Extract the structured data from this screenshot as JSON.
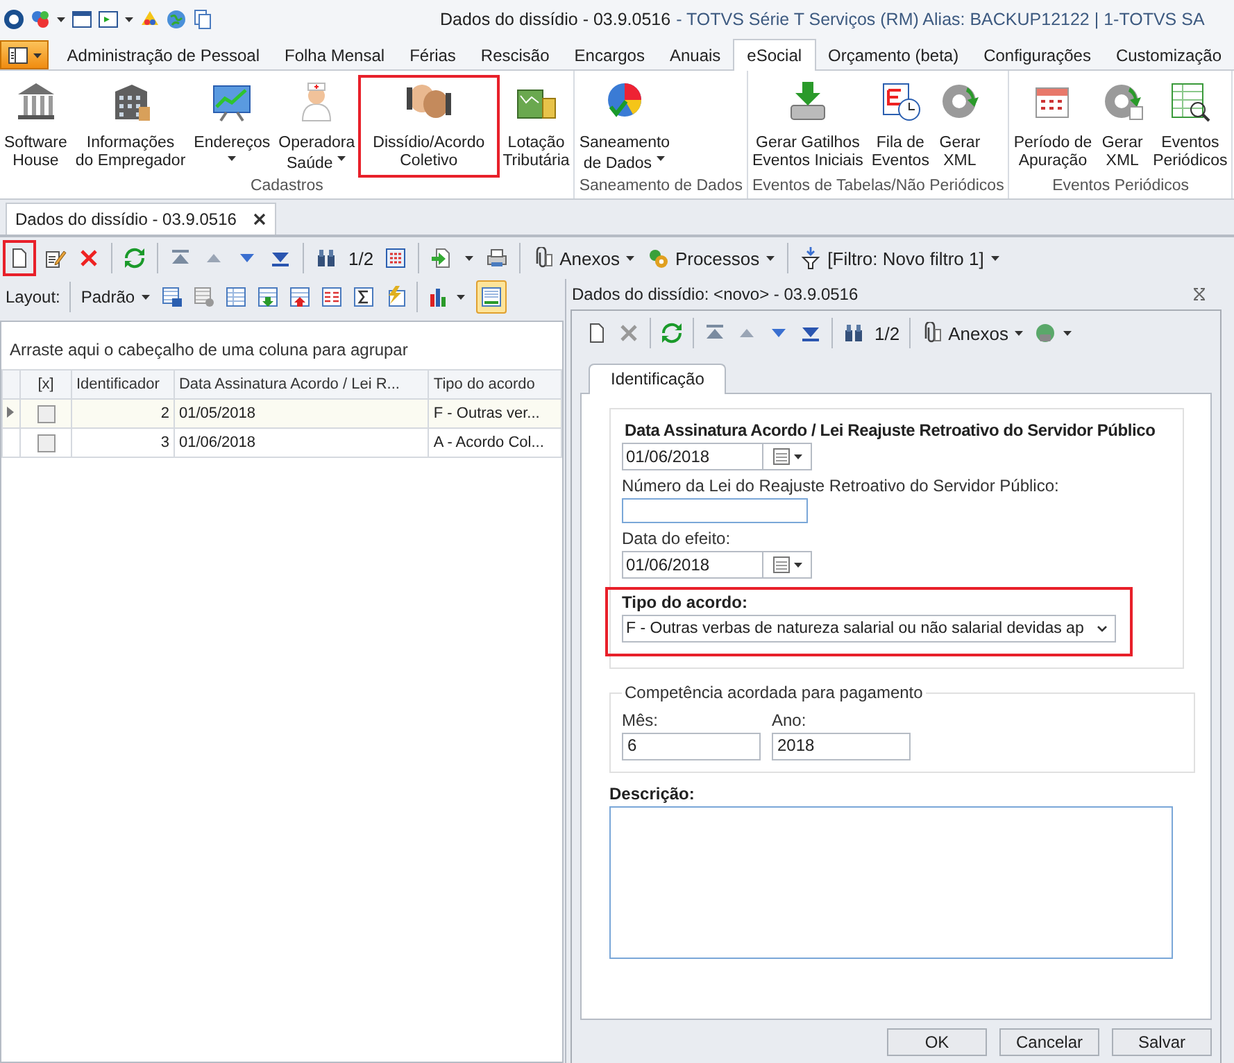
{
  "window": {
    "title": "Dados do dissídio - 03.9.0516",
    "subtitle": "- TOTVS Série T Serviços (RM) Alias: BACKUP12122 | 1-TOTVS SA"
  },
  "ribbon_tabs": [
    {
      "label": "Administração de Pessoal",
      "selected": false
    },
    {
      "label": "Folha Mensal",
      "selected": false
    },
    {
      "label": "Férias",
      "selected": false
    },
    {
      "label": "Rescisão",
      "selected": false
    },
    {
      "label": "Encargos",
      "selected": false
    },
    {
      "label": "Anuais",
      "selected": false
    },
    {
      "label": "eSocial",
      "selected": true
    },
    {
      "label": "Orçamento (beta)",
      "selected": false
    },
    {
      "label": "Configurações",
      "selected": false
    },
    {
      "label": "Customização",
      "selected": false
    }
  ],
  "ribbon_groups": [
    {
      "label": "Cadastros",
      "buttons": [
        {
          "lines": [
            "Software",
            "House"
          ],
          "dropdown": false,
          "highlighted": false
        },
        {
          "lines": [
            "Informações",
            "do Empregador"
          ],
          "dropdown": false,
          "highlighted": false
        },
        {
          "lines": [
            "Endereços"
          ],
          "dropdown": true,
          "highlighted": false
        },
        {
          "lines": [
            "Operadora",
            "Saúde"
          ],
          "dropdown": true,
          "highlighted": false
        },
        {
          "lines": [
            "Dissídio/Acordo",
            "Coletivo"
          ],
          "dropdown": false,
          "highlighted": true
        },
        {
          "lines": [
            "Lotação",
            "Tributária"
          ],
          "dropdown": false,
          "highlighted": false
        }
      ]
    },
    {
      "label": "Saneamento de Dados",
      "buttons": [
        {
          "lines": [
            "Saneamento",
            "de Dados"
          ],
          "dropdown": true,
          "highlighted": false
        }
      ]
    },
    {
      "label": "Eventos de Tabelas/Não Periódicos",
      "buttons": [
        {
          "lines": [
            "Gerar Gatilhos",
            "Eventos Iniciais"
          ],
          "dropdown": false,
          "highlighted": false
        },
        {
          "lines": [
            "Fila de",
            "Eventos"
          ],
          "dropdown": false,
          "highlighted": false
        },
        {
          "lines": [
            "Gerar",
            "XML"
          ],
          "dropdown": false,
          "highlighted": false
        }
      ]
    },
    {
      "label": "Eventos Periódicos",
      "buttons": [
        {
          "lines": [
            "Período de",
            "Apuração"
          ],
          "dropdown": false,
          "highlighted": false
        },
        {
          "lines": [
            "Gerar",
            "XML"
          ],
          "dropdown": false,
          "highlighted": false
        },
        {
          "lines": [
            "Eventos",
            "Periódicos"
          ],
          "dropdown": false,
          "highlighted": false
        }
      ]
    }
  ],
  "document_tab": {
    "label": "Dados do dissídio - 03.9.0516"
  },
  "toolbar": {
    "new_button": {
      "highlighted": true
    },
    "record_counter": "1/2",
    "attachments": "Anexos",
    "processes": "Processos",
    "filter": "[Filtro: Novo filtro 1]"
  },
  "layout_toolbar": {
    "label": "Layout:",
    "preset": "Padrão",
    "preview_panel": {
      "on": true
    }
  },
  "grid": {
    "group_hint": "Arraste aqui o cabeçalho de uma coluna para agrupar",
    "columns": [
      "[x]",
      "Identificador",
      "Data Assinatura Acordo / Lei R...",
      "Tipo do acordo"
    ],
    "rows": [
      {
        "selected": true,
        "checked": false,
        "id": "2",
        "date": "01/05/2018",
        "type": "F - Outras ver..."
      },
      {
        "selected": false,
        "checked": false,
        "id": "3",
        "date": "01/06/2018",
        "type": "A - Acordo Col..."
      }
    ]
  },
  "dialog": {
    "title": "Dados do dissídio: <novo> - 03.9.0516",
    "toolbar": {
      "record_counter": "1/2",
      "attachments": "Anexos"
    },
    "tabs": [
      {
        "label": "Identificação",
        "selected": true
      }
    ],
    "form": {
      "heading": "Data Assinatura Acordo / Lei Reajuste Retroativo do Servidor Público",
      "signature_date": "01/06/2018",
      "law_number_label": "Número da Lei do Reajuste Retroativo do Servidor Público:",
      "effect_date_label": "Data do efeito:",
      "effect_date": "01/06/2018",
      "agreement_type": {
        "label": "Tipo do acordo:",
        "value": "F - Outras verbas de natureza salarial ou não salarial devidas ap",
        "highlighted": true
      },
      "competence": {
        "title": "Competência acordada para pagamento",
        "month_label": "Mês:",
        "month": "6",
        "year_label": "Ano:",
        "year": "2018"
      },
      "description_label": "Descrição:"
    },
    "buttons": [
      "OK",
      "Cancelar",
      "Salvar"
    ]
  }
}
